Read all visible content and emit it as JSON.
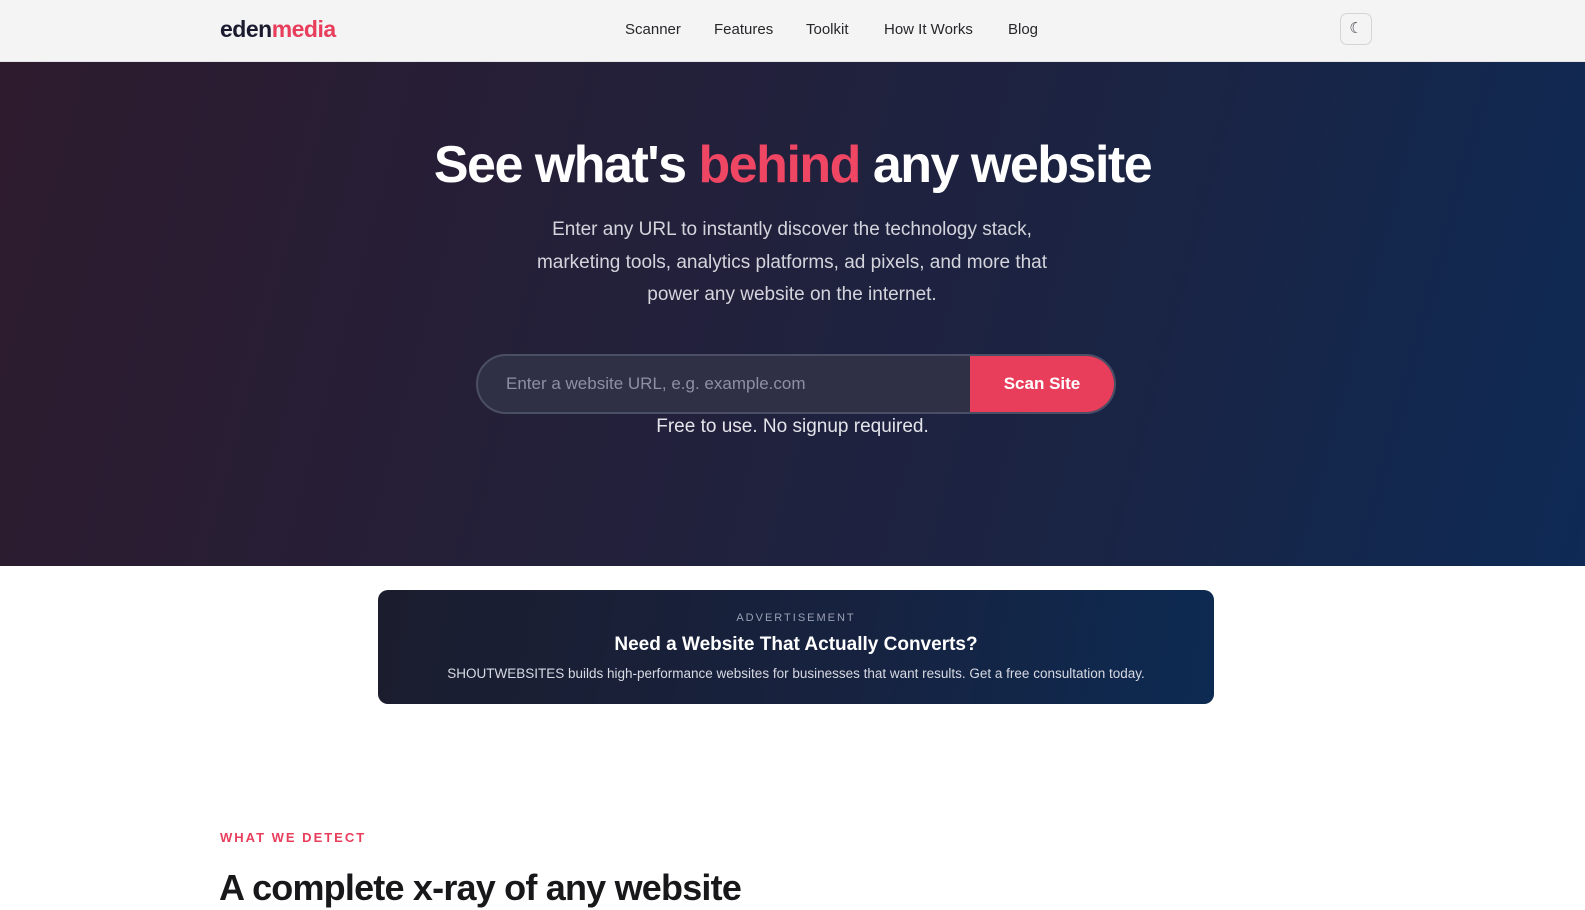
{
  "header": {
    "logo_part1": "eden",
    "logo_part2": "media",
    "nav": [
      "Scanner",
      "Features",
      "Toolkit",
      "How It Works",
      "Blog"
    ],
    "theme_toggle_icon": "☾"
  },
  "hero": {
    "title_before": "See what's ",
    "title_accent": "behind",
    "title_after": " any website",
    "subtitle": "Enter any URL to instantly discover the technology stack, marketing tools, analytics platforms, ad pixels, and more that power any website on the internet.",
    "search_placeholder": "Enter a website URL, e.g. example.com",
    "search_value": "",
    "scan_button": "Scan Site",
    "note": "Free to use. No signup required."
  },
  "ad": {
    "label": "ADVERTISEMENT",
    "title": "Need a Website That Actually Converts?",
    "text": "SHOUTWEBSITES builds high-performance websites for businesses that want results. Get a free consultation today."
  },
  "section": {
    "eyebrow": "WHAT WE DETECT",
    "title": "A complete x-ray of any website"
  },
  "colors": {
    "accent": "#e83e5c",
    "hero_bg_start": "#2e1b2e",
    "hero_bg_end": "#0e2a55",
    "header_bg": "#f4f4f5"
  }
}
